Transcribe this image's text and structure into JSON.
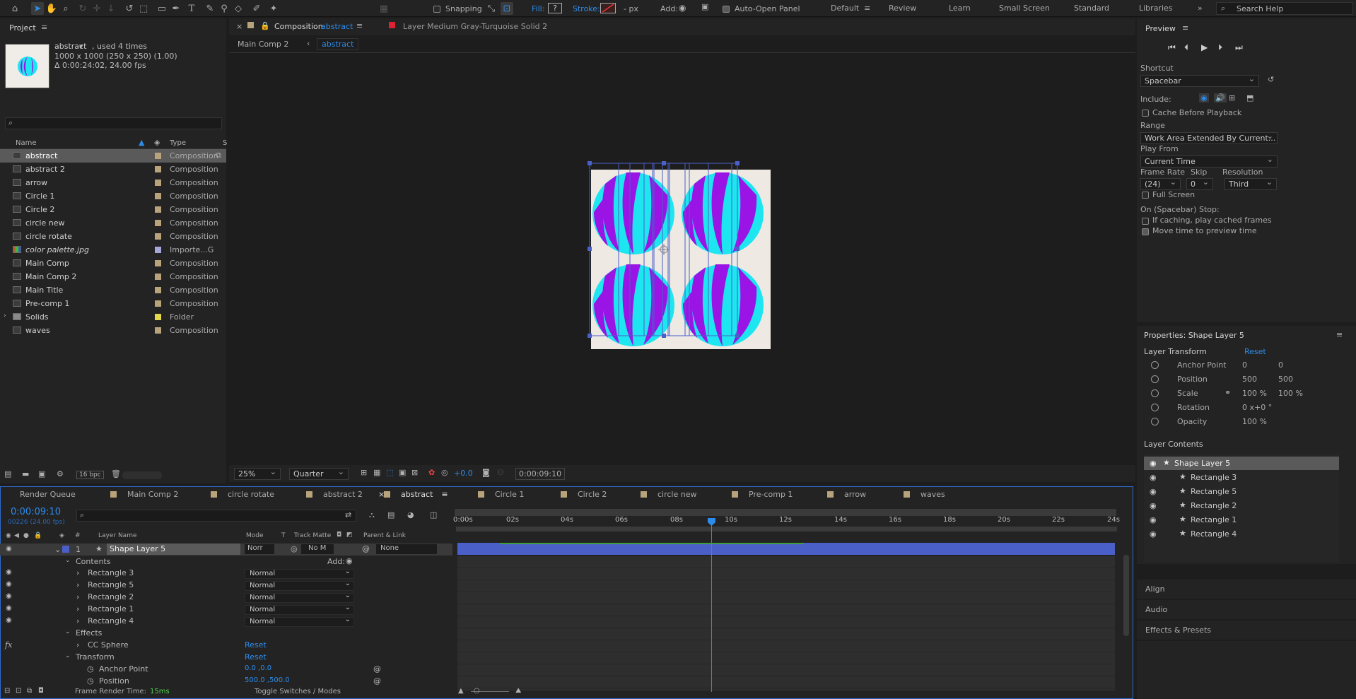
{
  "toolbar": {
    "snapping": "Snapping",
    "fill": "Fill:",
    "fill_value": "?",
    "stroke": "Stroke:",
    "px": "- px",
    "add": "Add:",
    "auto_open": "Auto-Open Panel",
    "workspaces": [
      "Default",
      "Review",
      "Learn",
      "Small Screen",
      "Standard",
      "Libraries"
    ],
    "search_placeholder": "Search Help"
  },
  "project": {
    "title": "Project",
    "item_name": "abstract",
    "used": ", used 4 times",
    "dims": "1000 x 1000  (250 x 250) (1.00)",
    "duration": "Δ 0:00:24:02, 24.00 fps",
    "col_name": "Name",
    "col_type": "Type",
    "col_s": "S",
    "items": [
      {
        "name": "abstract",
        "type": "Composition"
      },
      {
        "name": "abstract 2",
        "type": "Composition"
      },
      {
        "name": "arrow",
        "type": "Composition"
      },
      {
        "name": "Circle 1",
        "type": "Composition"
      },
      {
        "name": "Circle 2",
        "type": "Composition"
      },
      {
        "name": "circle new",
        "type": "Composition"
      },
      {
        "name": "circle rotate",
        "type": "Composition"
      },
      {
        "name": "color palette.jpg",
        "type": "Importe...G"
      },
      {
        "name": "Main Comp",
        "type": "Composition"
      },
      {
        "name": "Main Comp 2",
        "type": "Composition"
      },
      {
        "name": "Main Title",
        "type": "Composition"
      },
      {
        "name": "Pre-comp 1",
        "type": "Composition"
      },
      {
        "name": "Solids",
        "type": "Folder"
      },
      {
        "name": "waves",
        "type": "Composition"
      }
    ],
    "bpc": "16 bpc"
  },
  "comp": {
    "tab_prefix": "Composition",
    "tab_name": "abstract",
    "layer_tab": "Layer  Medium Gray-Turquoise Solid 2",
    "bc1": "Main Comp 2",
    "bc2": "abstract",
    "zoom": "25%",
    "quality": "Quarter",
    "exposure": "+0.0",
    "timecode": "0:00:09:10"
  },
  "colors": {
    "accent": "#2d8ceb",
    "cyan": "#1ee6f0",
    "purple": "#9a14e6",
    "bg_comp": "#eee9e3",
    "layer_bar": "#4b5fc9",
    "label": "#b9a37a"
  },
  "timeline": {
    "tabs": [
      "Render Queue",
      "Main Comp 2",
      "circle rotate",
      "abstract 2",
      "abstract",
      "Circle 1",
      "Circle 2",
      "circle new",
      "Pre-comp 1",
      "arrow",
      "waves"
    ],
    "time": "0:00:09:10",
    "frames": "00226 (24.00 fps)",
    "cols": {
      "num": "#",
      "name": "Layer Name",
      "mode": "Mode",
      "t": "T",
      "matte": "Track Matte",
      "parent": "Parent & Link"
    },
    "layer": {
      "num": "1",
      "name": "Shape Layer 5",
      "mode": "Norr",
      "matte": "No M",
      "parent": "None"
    },
    "contents": "Contents",
    "add": "Add:",
    "rects": [
      "Rectangle 3",
      "Rectangle 5",
      "Rectangle 2",
      "Rectangle 1",
      "Rectangle 4"
    ],
    "rect_mode": "Normal",
    "effects": "Effects",
    "cc_sphere": "CC Sphere",
    "reset": "Reset",
    "transform": "Transform",
    "anchor": "Anchor Point",
    "anchor_val": "0.0 ,0.0",
    "position": "Position",
    "position_val": "500.0 ,500.0",
    "ruler": [
      "0:00s",
      "02s",
      "04s",
      "06s",
      "08s",
      "10s",
      "12s",
      "14s",
      "16s",
      "18s",
      "20s",
      "22s",
      "24s"
    ],
    "render_time_label": "Frame Render Time:",
    "render_time": "15ms",
    "toggle": "Toggle Switches / Modes",
    "playhead_fraction": 0.386
  },
  "preview": {
    "title": "Preview",
    "shortcut": "Shortcut",
    "shortcut_val": "Spacebar",
    "include": "Include:",
    "cache": "Cache Before Playback",
    "range": "Range",
    "range_val": "Work Area Extended By Current...",
    "play_from": "Play From",
    "play_from_val": "Current Time",
    "frame_rate": "Frame Rate",
    "skip": "Skip",
    "resolution": "Resolution",
    "fr_val": "(24)",
    "skip_val": "0",
    "res_val": "Third",
    "full_screen": "Full Screen",
    "on_stop": "On (Spacebar) Stop:",
    "if_caching": "If caching, play cached frames",
    "move_time": "Move time to preview time"
  },
  "properties": {
    "title": "Properties: Shape Layer 5",
    "layer_transform": "Layer Transform",
    "reset": "Reset",
    "rows": [
      {
        "label": "Anchor Point",
        "v1": "0",
        "v2": "0"
      },
      {
        "label": "Position",
        "v1": "500",
        "v2": "500"
      },
      {
        "label": "Scale",
        "v1": "100 %",
        "v2": "100 %"
      },
      {
        "label": "Rotation",
        "v1": "0 x+0 °",
        "v2": ""
      },
      {
        "label": "Opacity",
        "v1": "100 %",
        "v2": ""
      }
    ],
    "layer_contents": "Layer Contents",
    "contents": [
      "Shape Layer 5",
      "Rectangle 3",
      "Rectangle 5",
      "Rectangle 2",
      "Rectangle 1",
      "Rectangle 4"
    ]
  },
  "side": {
    "align": "Align",
    "audio": "Audio",
    "effects": "Effects & Presets"
  }
}
